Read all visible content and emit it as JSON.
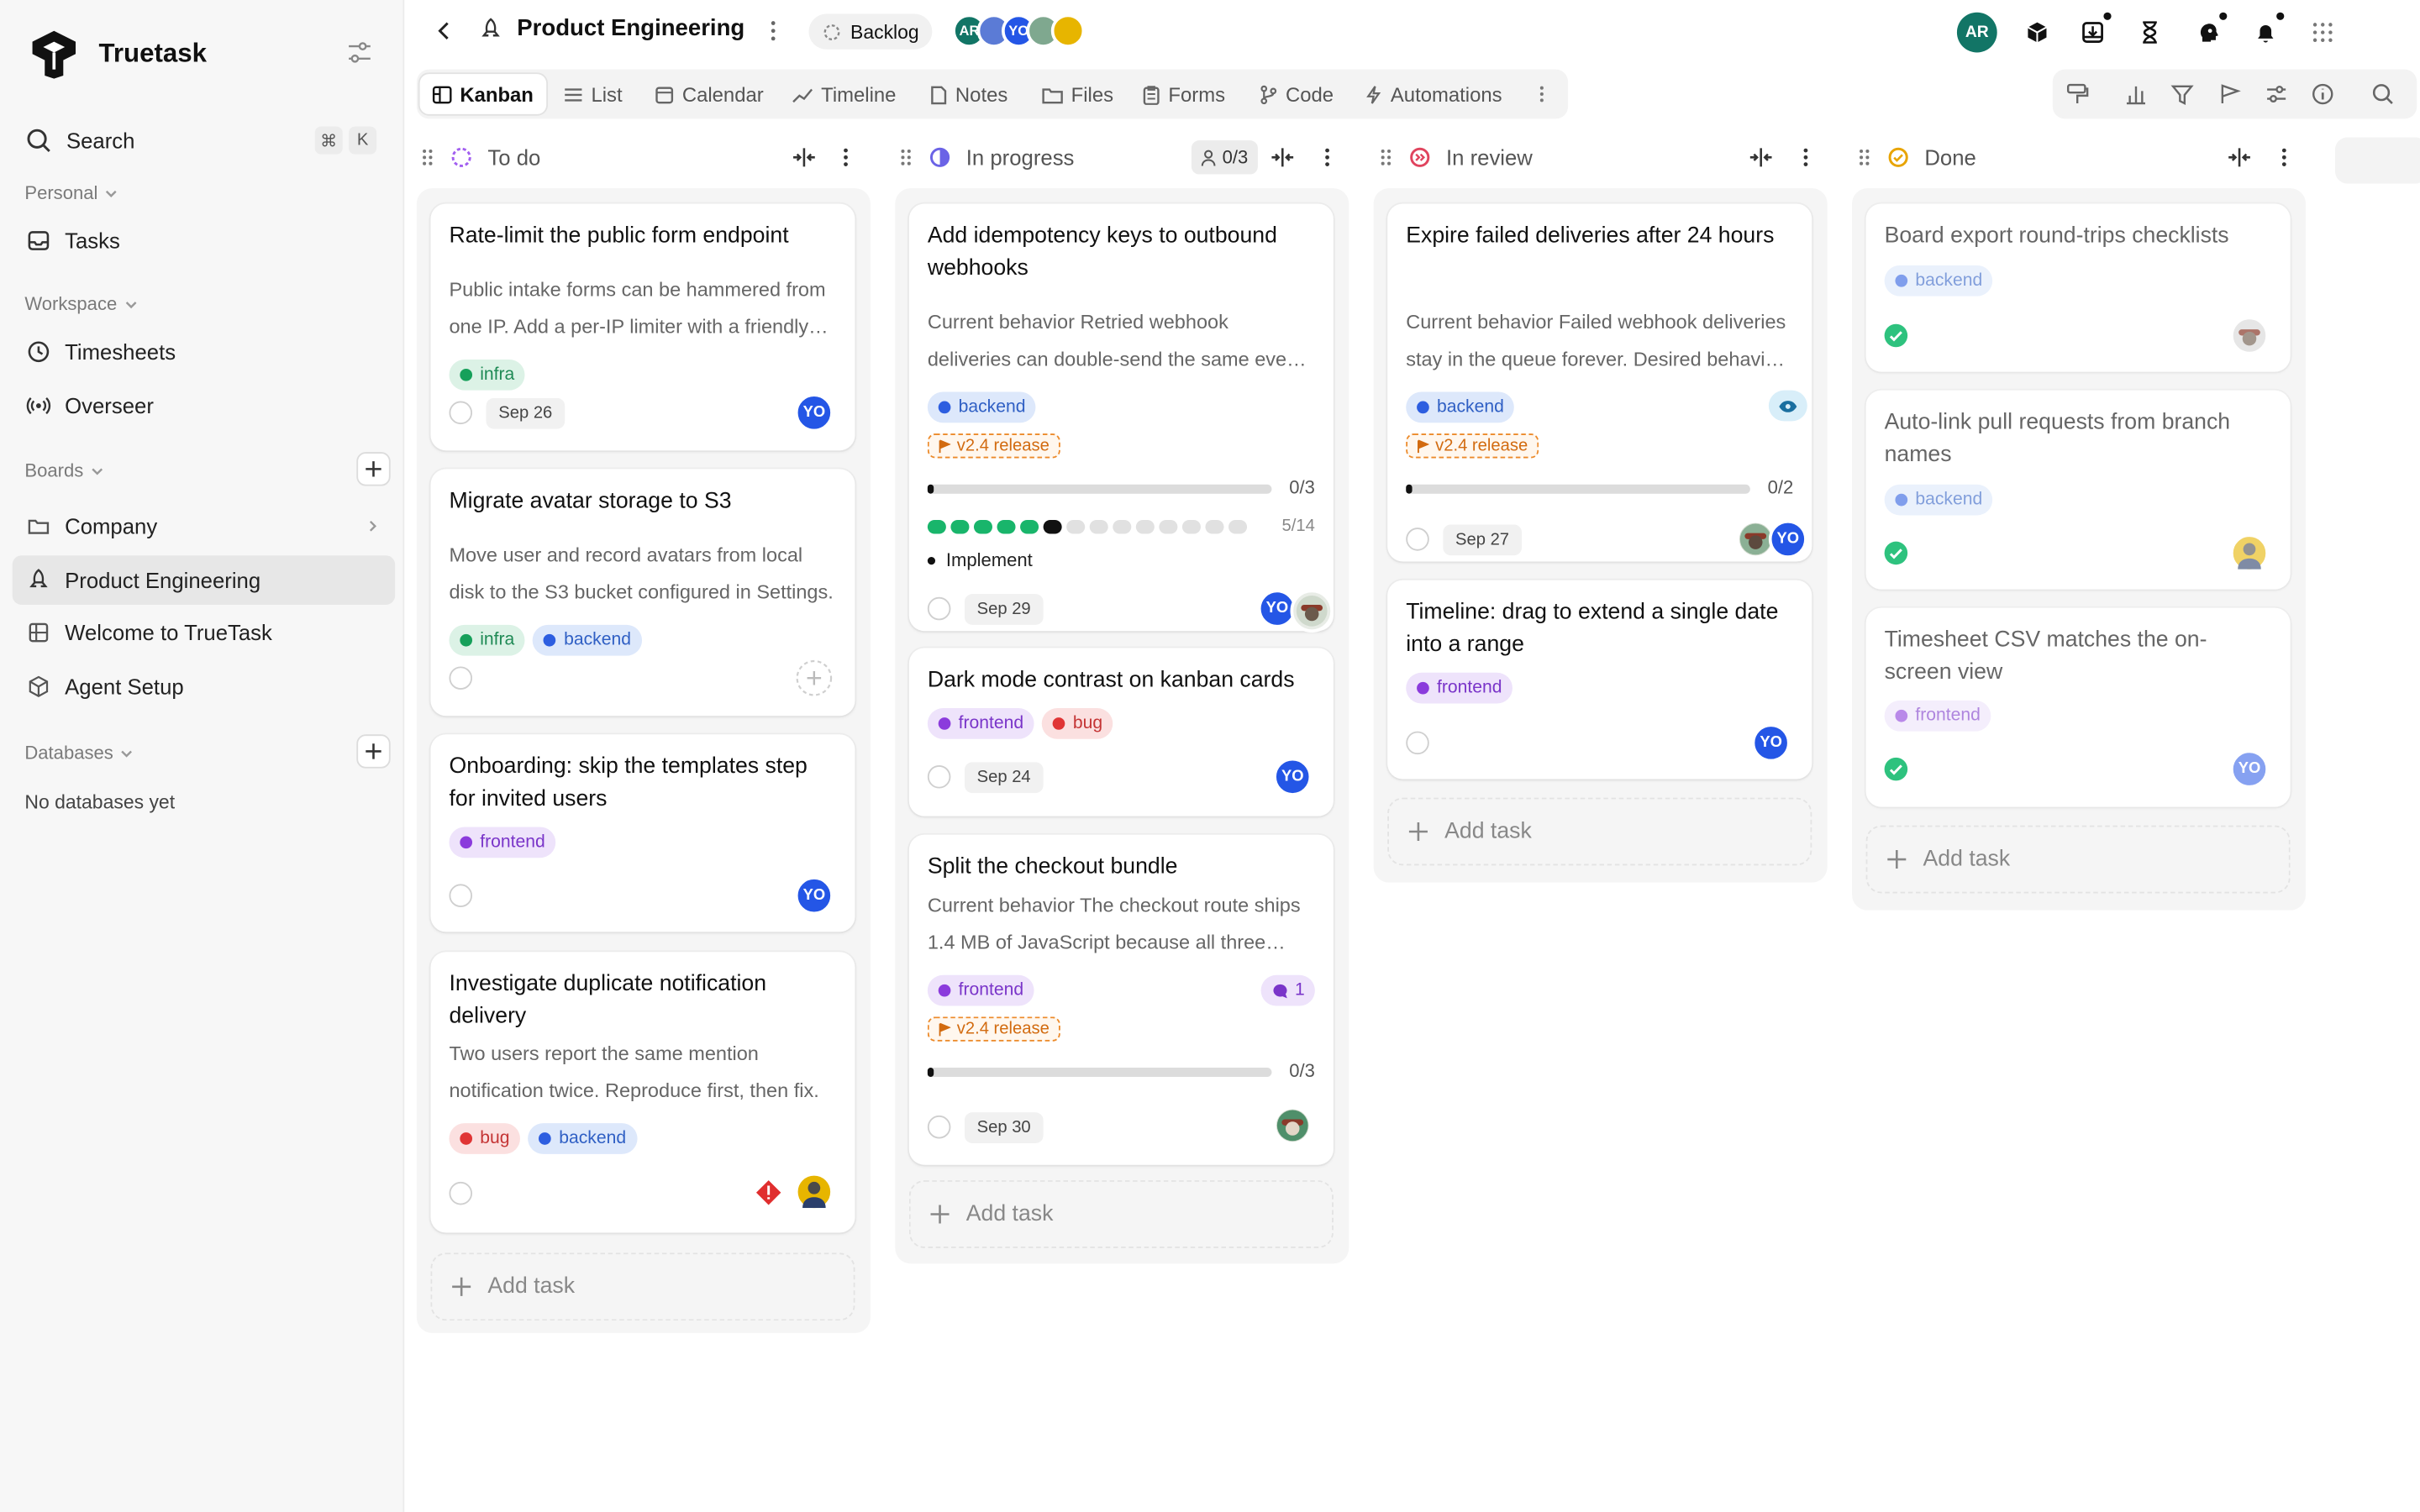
{
  "app": {
    "name": "Truetask"
  },
  "sidebar": {
    "search_label": "Search",
    "shortcut_keys": [
      "⌘",
      "K"
    ],
    "personal_label": "Personal",
    "tasks_label": "Tasks",
    "workspace_label": "Workspace",
    "timesheets_label": "Timesheets",
    "overseer_label": "Overseer",
    "boards_label": "Boards",
    "boards": [
      "Company",
      "Product Engineering",
      "Welcome to TrueTask",
      "Agent Setup"
    ],
    "databases_label": "Databases",
    "databases_empty": "No databases yet"
  },
  "topbar": {
    "project_title": "Product Engineering",
    "status_label": "Backlog",
    "member_avatars": [
      {
        "initials": "AR",
        "color": "#127566"
      },
      {
        "initials": "",
        "color": "#5b7bd6"
      },
      {
        "initials": "YO",
        "color": "#2456e6"
      },
      {
        "initials": "",
        "color": "#7fa88f"
      },
      {
        "initials": "",
        "color": "#e7b500"
      }
    ],
    "user_initials": "AR"
  },
  "views": {
    "tabs": [
      "Kanban",
      "List",
      "Calendar",
      "Timeline",
      "Notes",
      "Files",
      "Forms",
      "Code",
      "Automations"
    ],
    "active": "Kanban"
  },
  "columns": {
    "todo": {
      "title": "To do"
    },
    "inprogress": {
      "title": "In progress",
      "assignee_count": "0/3"
    },
    "review": {
      "title": "In review"
    },
    "done": {
      "title": "Done"
    }
  },
  "cards": {
    "c1": {
      "title": "Rate-limit the public form endpoint",
      "desc": "Public intake forms can be hammered from one IP. Add a per-IP limiter with a friendly message on rejection.",
      "tags": [
        "infra"
      ],
      "date": "Sep 26",
      "assignee": "YO"
    },
    "c2": {
      "title": "Migrate avatar storage to S3",
      "desc": "Move user and record avatars from local disk to the S3 bucket configured in Settings.",
      "tags": [
        "infra",
        "backend"
      ]
    },
    "c3": {
      "title": "Onboarding: skip the templates step for invited users",
      "tags": [
        "frontend"
      ],
      "assignee": "YO"
    },
    "c4": {
      "title": "Investigate duplicate notification delivery",
      "desc": "Two users report the same mention notification twice. Reproduce first, then fix.",
      "tags": [
        "bug",
        "backend"
      ]
    },
    "p1": {
      "title": "Add idempotency keys to outbound webhooks",
      "desc": "Current behavior Retried webhook deliveries can double-send the same event to subscribers.",
      "tags": [
        "backend"
      ],
      "release": "v2.4 release",
      "progress": "0/3",
      "steps": "5/14",
      "step_label": "Implement",
      "date": "Sep 29",
      "assignee": "YO"
    },
    "p2": {
      "title": "Dark mode contrast on kanban cards",
      "tags": [
        "frontend",
        "bug"
      ],
      "date": "Sep 24",
      "assignee": "YO"
    },
    "p3": {
      "title": "Split the checkout bundle",
      "desc": "Current behavior The checkout route ships 1.4 MB of JavaScript because all three payment providers load.",
      "tags": [
        "frontend"
      ],
      "comments": "1",
      "release": "v2.4 release",
      "progress": "0/3",
      "date": "Sep 30"
    },
    "r1": {
      "title": "Expire failed deliveries after 24 hours",
      "desc": "Current behavior Failed webhook deliveries stay in the queue forever. Desired behavior: expire them.",
      "tags": [
        "backend"
      ],
      "release": "v2.4 release",
      "progress": "0/2",
      "date": "Sep 27",
      "assignee": "YO"
    },
    "r2": {
      "title": "Timeline: drag to extend a single date into a range",
      "tags": [
        "frontend"
      ],
      "assignee": "YO"
    },
    "d1": {
      "title": "Board export round-trips checklists",
      "tags": [
        "backend"
      ]
    },
    "d2": {
      "title": "Auto-link pull requests from branch names",
      "tags": [
        "backend"
      ]
    },
    "d3": {
      "title": "Timesheet CSV matches the on-screen view",
      "tags": [
        "frontend"
      ],
      "assignee": "YO"
    }
  },
  "add_task_label": "Add task",
  "colors": {
    "accent": "#2456e6",
    "infra": "#16a05a",
    "backend": "#2d5ee0",
    "frontend": "#8b3bdc",
    "bug": "#e03434",
    "release": "#ec8a2a",
    "done": "#2ec27e"
  }
}
